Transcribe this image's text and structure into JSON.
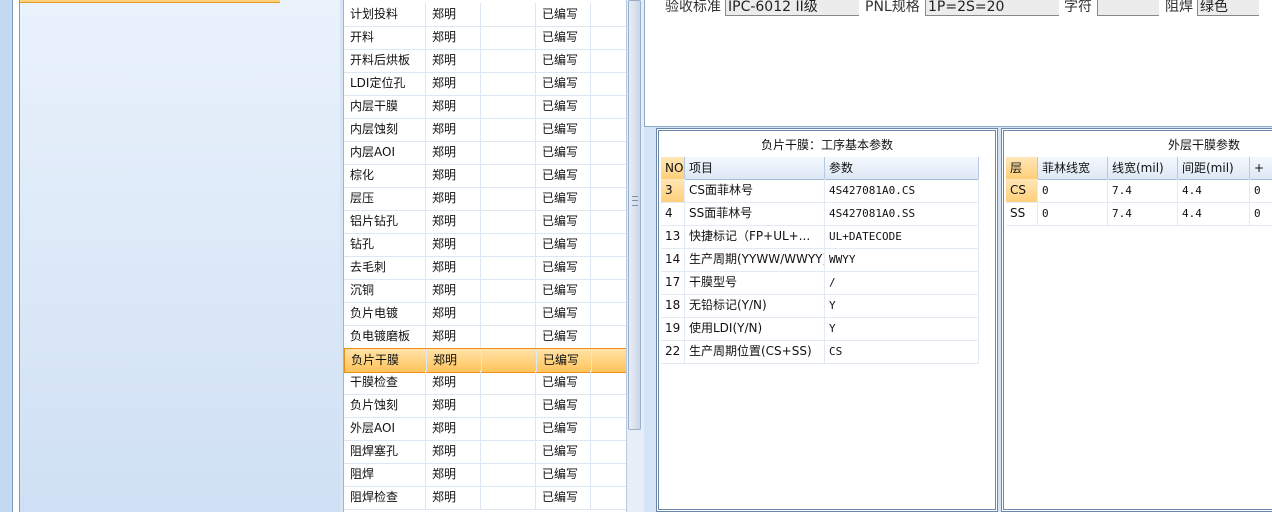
{
  "process_list": {
    "rows": [
      {
        "name": "计划投料",
        "author": "郑明",
        "status": "已编写"
      },
      {
        "name": "开料",
        "author": "郑明",
        "status": "已编写"
      },
      {
        "name": "开料后烘板",
        "author": "郑明",
        "status": "已编写"
      },
      {
        "name": "LDI定位孔",
        "author": "郑明",
        "status": "已编写"
      },
      {
        "name": "内层干膜",
        "author": "郑明",
        "status": "已编写"
      },
      {
        "name": "内层蚀刻",
        "author": "郑明",
        "status": "已编写"
      },
      {
        "name": "内层AOI",
        "author": "郑明",
        "status": "已编写"
      },
      {
        "name": "棕化",
        "author": "郑明",
        "status": "已编写"
      },
      {
        "name": "层压",
        "author": "郑明",
        "status": "已编写"
      },
      {
        "name": "铝片钻孔",
        "author": "郑明",
        "status": "已编写"
      },
      {
        "name": "钻孔",
        "author": "郑明",
        "status": "已编写"
      },
      {
        "name": "去毛刺",
        "author": "郑明",
        "status": "已编写"
      },
      {
        "name": "沉铜",
        "author": "郑明",
        "status": "已编写"
      },
      {
        "name": "负片电镀",
        "author": "郑明",
        "status": "已编写"
      },
      {
        "name": "负电镀磨板",
        "author": "郑明",
        "status": "已编写"
      },
      {
        "name": "负片干膜",
        "author": "郑明",
        "status": "已编写"
      },
      {
        "name": "干膜检查",
        "author": "郑明",
        "status": "已编写"
      },
      {
        "name": "负片蚀刻",
        "author": "郑明",
        "status": "已编写"
      },
      {
        "name": "外层AOI",
        "author": "郑明",
        "status": "已编写"
      },
      {
        "name": "阻焊塞孔",
        "author": "郑明",
        "status": "已编写"
      },
      {
        "name": "阻焊",
        "author": "郑明",
        "status": "已编写"
      },
      {
        "name": "阻焊检查",
        "author": "郑明",
        "status": "已编写"
      }
    ]
  },
  "top_fields": {
    "acceptance_label": "验收标准",
    "acceptance_value": "IPC-6012 II级",
    "pnl_label": "PNL规格",
    "pnl_value": "1P=2S=20",
    "char_label": "字符",
    "char_value": "",
    "mask_label": "阻焊",
    "mask_value": "绿色"
  },
  "params_panel": {
    "title": "负片干膜：工序基本参数",
    "headers": {
      "no": "NO",
      "item": "项目",
      "param": "参数"
    },
    "rows": [
      {
        "no": "3",
        "item": "CS面菲林号",
        "param": "4S427081A0.CS"
      },
      {
        "no": "4",
        "item": "SS面菲林号",
        "param": "4S427081A0.SS"
      },
      {
        "no": "13",
        "item": "快捷标记（FP+UL+...",
        "param": "UL+DATECODE"
      },
      {
        "no": "14",
        "item": "生产周期(YYWW/WWYY)",
        "param": "WWYY"
      },
      {
        "no": "17",
        "item": "干膜型号",
        "param": "/"
      },
      {
        "no": "18",
        "item": "无铅标记(Y/N)",
        "param": "Y"
      },
      {
        "no": "19",
        "item": "使用LDI(Y/N)",
        "param": "Y"
      },
      {
        "no": "22",
        "item": "生产周期位置(CS+SS)",
        "param": "CS"
      }
    ]
  },
  "outer_panel": {
    "title": "外层干膜参数",
    "headers": {
      "layer": "层",
      "film_width": "菲林线宽",
      "line_width": "线宽(mil)",
      "spacing": "间距(mil)",
      "plus": "+"
    },
    "rows": [
      {
        "layer": "CS",
        "film_width": "0",
        "line_width": "7.4",
        "spacing": "4.4",
        "extra": "0"
      },
      {
        "layer": "SS",
        "film_width": "0",
        "line_width": "7.4",
        "spacing": "4.4",
        "extra": "0"
      }
    ]
  }
}
